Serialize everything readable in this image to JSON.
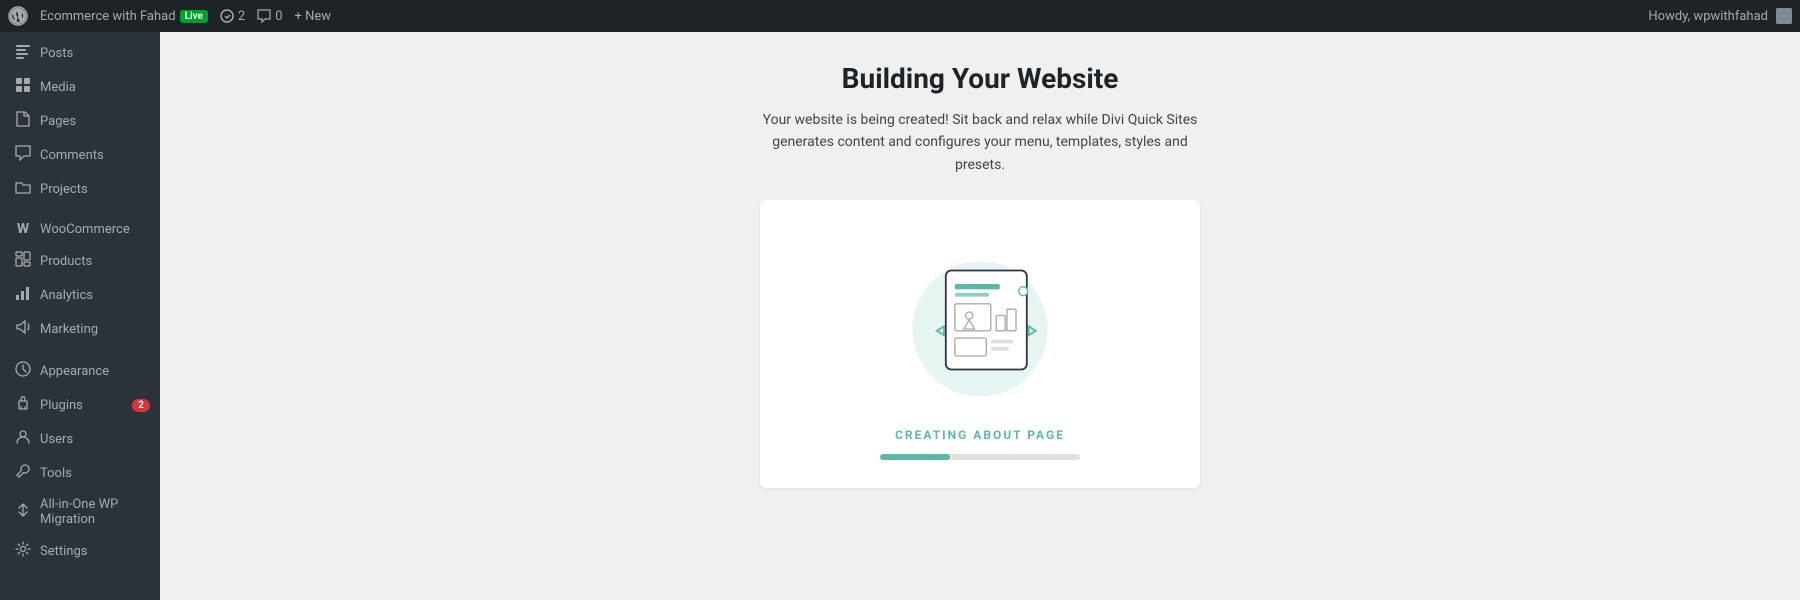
{
  "adminBar": {
    "logo": "wordpress-icon",
    "siteName": "Ecommerce with Fahad",
    "liveBadge": "Live",
    "updates": "2",
    "comments": "0",
    "new": "+ New",
    "howdy": "Howdy, wpwithfahad"
  },
  "sidebar": {
    "items": [
      {
        "id": "posts",
        "label": "Posts",
        "icon": "📝"
      },
      {
        "id": "media",
        "label": "Media",
        "icon": "🖼"
      },
      {
        "id": "pages",
        "label": "Pages",
        "icon": "📄"
      },
      {
        "id": "comments",
        "label": "Comments",
        "icon": "💬"
      },
      {
        "id": "projects",
        "label": "Projects",
        "icon": "📁"
      },
      {
        "id": "divider1",
        "label": "",
        "icon": ""
      },
      {
        "id": "woocommerce",
        "label": "WooCommerce",
        "icon": "🛒"
      },
      {
        "id": "products",
        "label": "Products",
        "icon": "📦"
      },
      {
        "id": "analytics",
        "label": "Analytics",
        "icon": "📊"
      },
      {
        "id": "marketing",
        "label": "Marketing",
        "icon": "📣"
      },
      {
        "id": "divider2",
        "label": "",
        "icon": ""
      },
      {
        "id": "appearance",
        "label": "Appearance",
        "icon": "🎨"
      },
      {
        "id": "plugins",
        "label": "Plugins",
        "icon": "🔌",
        "badge": "2"
      },
      {
        "id": "users",
        "label": "Users",
        "icon": "👤"
      },
      {
        "id": "tools",
        "label": "Tools",
        "icon": "🔧"
      },
      {
        "id": "aio-migration",
        "label": "All-in-One WP Migration",
        "icon": "↕"
      },
      {
        "id": "settings",
        "label": "Settings",
        "icon": "⚙"
      }
    ]
  },
  "mainContent": {
    "title": "Building Your Website",
    "subtitle": "Your website is being created! Sit back and relax while Divi Quick Sites\ngenerates content and configures your menu, templates, styles and\npresets.",
    "card": {
      "creatingLabel": "CREATING ABOUT PAGE",
      "progressPercent": 35
    }
  }
}
